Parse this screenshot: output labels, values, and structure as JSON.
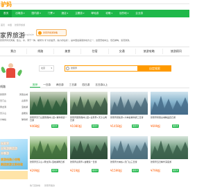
{
  "header": {
    "logo_text": "驴妈"
  },
  "nav": {
    "items": [
      {
        "label": "首页",
        "caret": ""
      },
      {
        "label": "出境游",
        "caret": "▾"
      },
      {
        "label": "国内游",
        "caret": "▾"
      },
      {
        "label": "门票",
        "caret": "▾"
      },
      {
        "label": "酒店",
        "caret": "▾"
      },
      {
        "label": "主题游",
        "caret": "▾"
      },
      {
        "label": "邮轮游",
        "caret": ""
      },
      {
        "label": "攻略",
        "caret": "▾"
      },
      {
        "label": "目的地",
        "caret": "▾"
      },
      {
        "label": "企业游",
        "caret": ""
      }
    ]
  },
  "breadcrumb": {
    "items": [
      "首页",
      "中国",
      "张家界旅游"
    ]
  },
  "city": {
    "name": "家界旅游",
    "en": "Zhangjiajie",
    "badge_text": "张家界旅游攻略",
    "desc": "张家界风光秀美，集山、水、洞于一体，被誉为“扩大的盆景，缩小的仙境”，是中国最美丽的地方之一，这里奇峰林立，怪石嶙峋，溪流潺潺。"
  },
  "categories": [
    {
      "label": "景点"
    },
    {
      "label": "线路"
    },
    {
      "label": "美食"
    },
    {
      "label": "住宿"
    },
    {
      "label": "交通"
    },
    {
      "label": "旅游攻略"
    },
    {
      "label": "旅游顾问"
    }
  ],
  "search": {
    "select_value": "北京",
    "select_caret": "▾",
    "query": "张家界",
    "button_label": "自定搜索"
  },
  "sidebar": {
    "section_label": "线路",
    "rows": [
      {
        "left": "张家界",
        "right": "凤凰古城"
      },
      {
        "left": "天门山",
        "right": "袁家界"
      },
      {
        "left": "黄龙洞",
        "right": "宝峰湖"
      },
      {
        "left": "天子山",
        "right": "金鞭溪"
      },
      {
        "left": "大峡谷",
        "right": "玻璃桥"
      }
    ],
    "promo_line1": "张家界",
    "promo_line2": "自驾游跟团游",
    "promo_line3": "去哪游",
    "promo_line4": "旅游线路小攻略",
    "promo_line5": "跟团旅游立即体验"
  },
  "tabs": [
    {
      "label": "推荐",
      "active": true
    },
    {
      "label": "一日游",
      "active": false
    },
    {
      "label": "两日游",
      "active": false
    },
    {
      "label": "三日游",
      "active": false
    },
    {
      "label": "四日游",
      "active": false
    },
    {
      "label": "五日游以上",
      "active": false
    }
  ],
  "products": [
    {
      "title": "张家界天门山国家森林公园+玻璃栈道一日游",
      "price": "¥468起",
      "tag": "跟团游",
      "colors": [
        "#2d5a3a",
        "#6f8f6a",
        "#c9d3c0"
      ]
    },
    {
      "title": "张家界国家森林公园+袁家界+天子山两日游",
      "price": "¥1080起",
      "tag": "跟团游",
      "colors": [
        "#3c5b45",
        "#8aa683",
        "#e2e6dc"
      ]
    },
    {
      "title": "张家界武陵源+大峡谷玻璃桥三日游",
      "price": "¥1458起",
      "tag": "跟团游",
      "colors": [
        "#4a6a7a",
        "#9db7c0",
        "#dfe9ee"
      ]
    },
    {
      "title": "张家界凤凰古城精品四日游",
      "price": "¥699起",
      "tag": "跟团游",
      "colors": [
        "#456c8a",
        "#86b3cc",
        "#cfe3ee"
      ]
    },
    {
      "title": "张家界天子山+黄龙洞+宝峰湖两日游",
      "price": "¥299起",
      "tag": "跟团游",
      "colors": [
        "#3f6d3c",
        "#7faa6c",
        "#d5e6c8"
      ]
    },
    {
      "title": "张家界袁家界+金鞭溪一日游",
      "price": "¥219起",
      "tag": "跟团游",
      "colors": [
        "#2f4d3a",
        "#5f8a6a",
        "#b7cbb8"
      ]
    },
    {
      "title": "张家界大峡谷+天门山三日游",
      "price": "¥1599起",
      "tag": "跟团游",
      "colors": [
        "#4d6f7d",
        "#8fb0bb",
        "#dfeaee"
      ]
    },
    {
      "title": "张家界五日精华深度游",
      "price": "¥799起",
      "tag": "跟团游",
      "colors": [
        "#3a5f4a",
        "#7ea58b",
        "#d6e5da"
      ]
    }
  ],
  "bottom": {
    "items": [
      "热门目的地",
      "张家界美食"
    ]
  }
}
